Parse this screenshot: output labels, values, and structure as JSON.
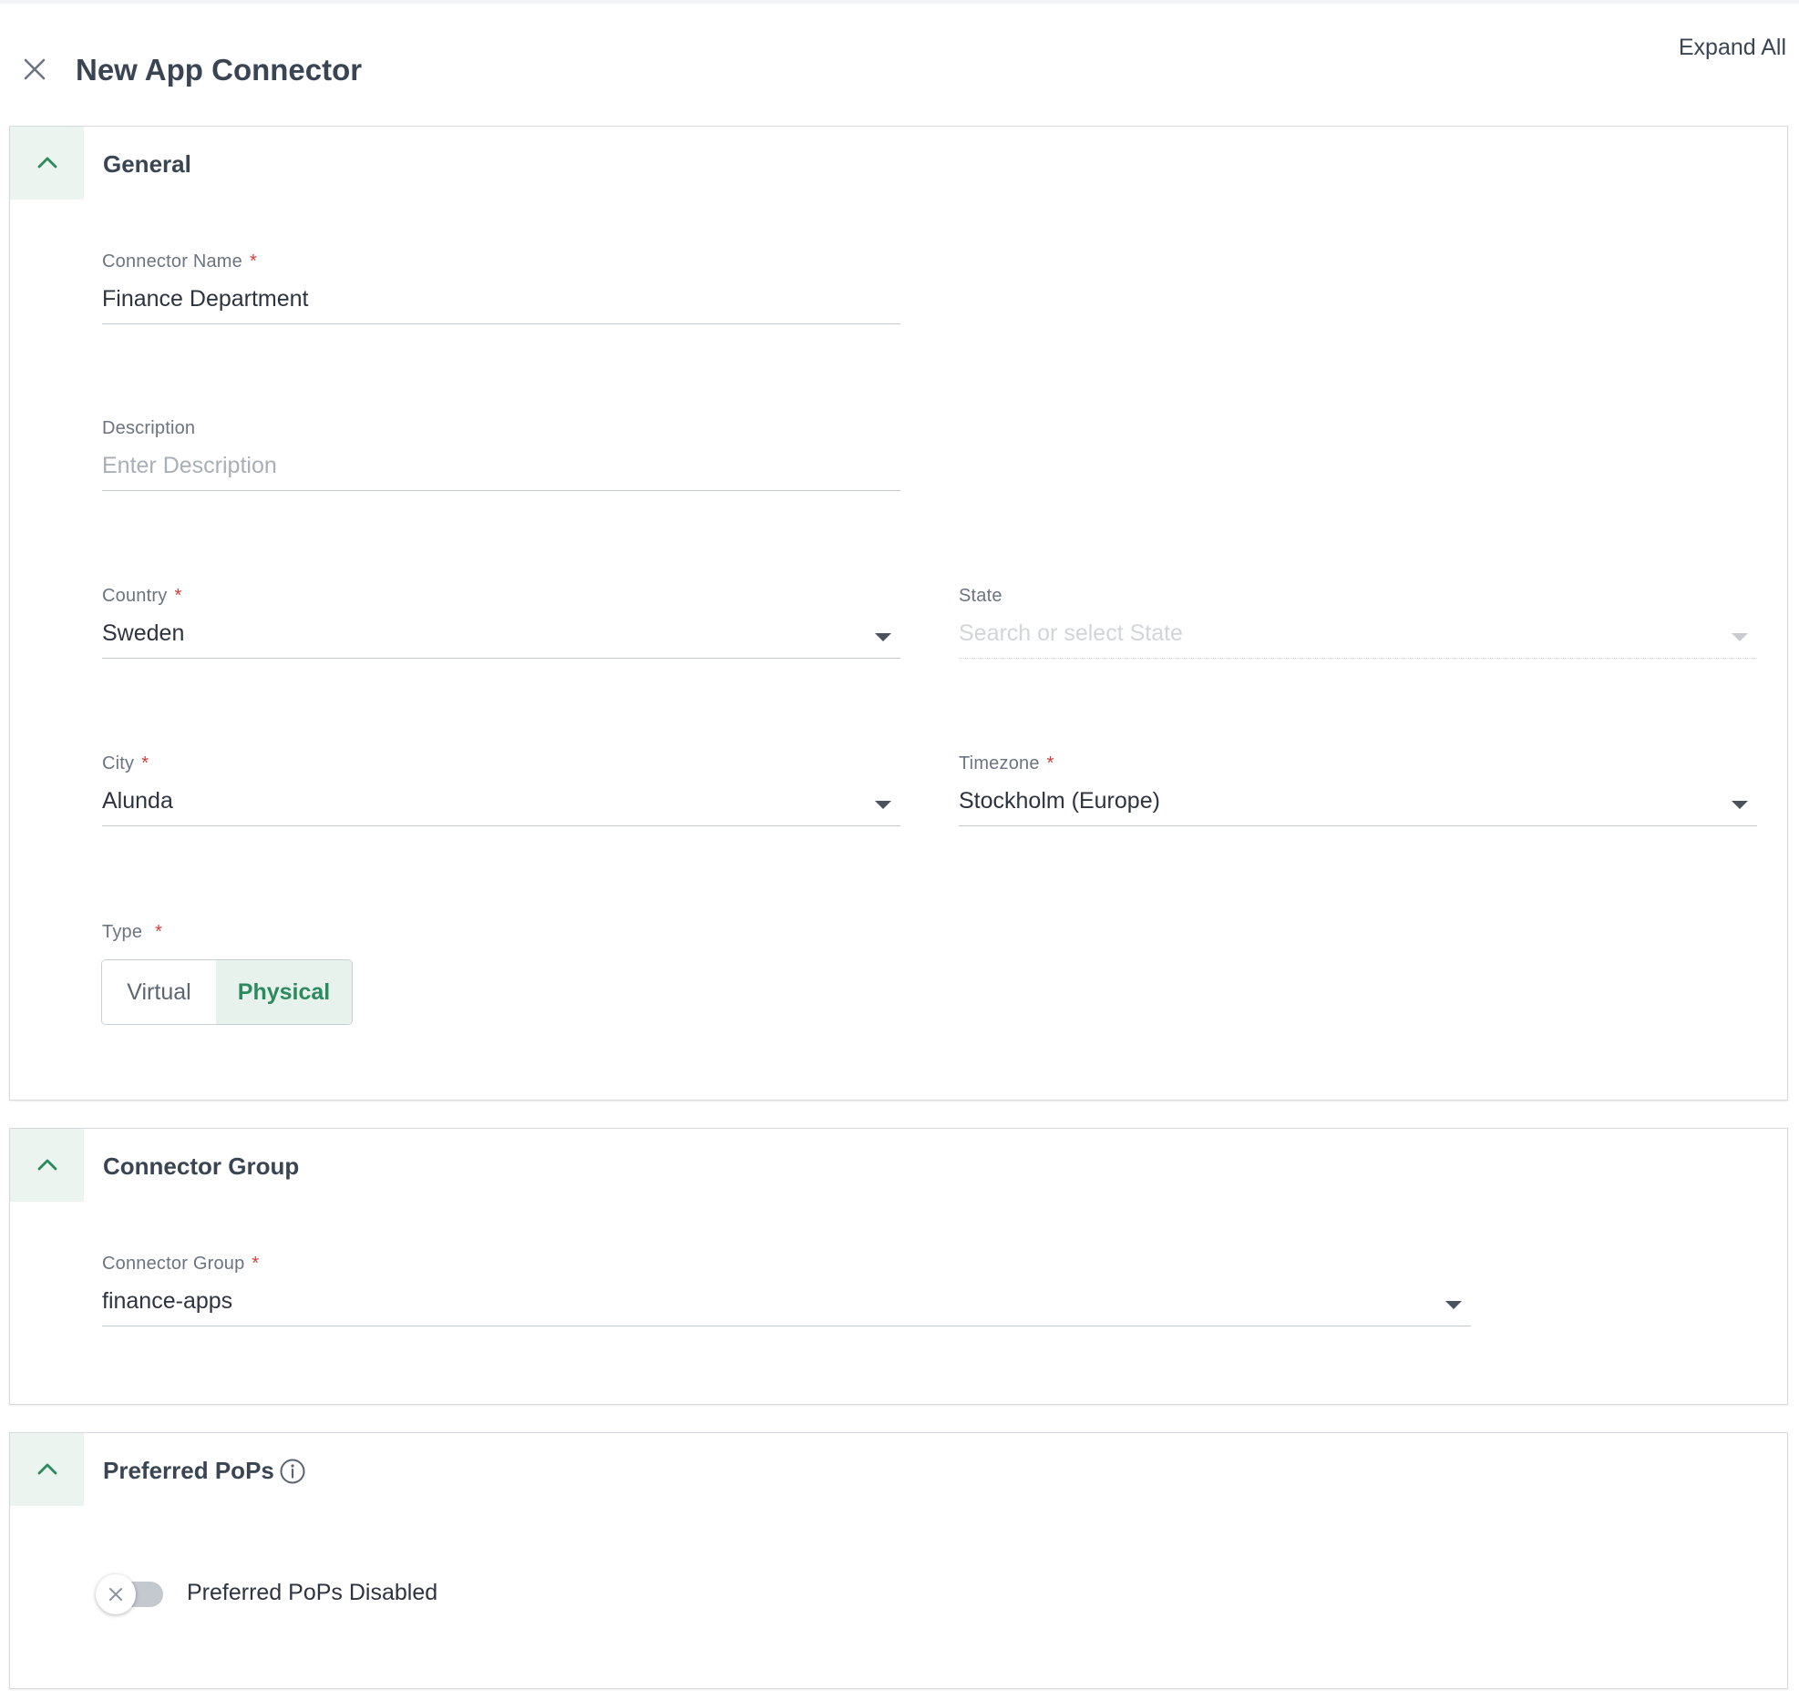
{
  "header": {
    "title": "New App Connector",
    "expand_all_label": "Expand All"
  },
  "general": {
    "title": "General",
    "connector_name": {
      "label": "Connector Name",
      "value": "Finance Department",
      "required": "*"
    },
    "description": {
      "label": "Description",
      "placeholder": "Enter Description",
      "value": ""
    },
    "country": {
      "label": "Country",
      "value": "Sweden",
      "required": "*"
    },
    "state": {
      "label": "State",
      "placeholder": "Search or select State"
    },
    "city": {
      "label": "City",
      "value": "Alunda",
      "required": "*"
    },
    "timezone": {
      "label": "Timezone",
      "value": "Stockholm (Europe)",
      "required": "*"
    },
    "type": {
      "label": "Type",
      "required": "*",
      "options": [
        "Virtual",
        "Physical"
      ],
      "selected": "Physical"
    }
  },
  "connector_group": {
    "title": "Connector Group",
    "field": {
      "label": "Connector Group",
      "value": "finance-apps",
      "required": "*"
    }
  },
  "preferred_pops": {
    "title": "Preferred PoPs",
    "toggle_label": "Preferred PoPs Disabled",
    "toggle_on": false
  },
  "colors": {
    "accent": "#2d8a5e",
    "accent_bg": "#e6f2eb",
    "required": "#d43b3b"
  },
  "icons": [
    "close-icon",
    "chevron-up-icon",
    "caret-down-icon",
    "info-icon",
    "x-icon"
  ]
}
